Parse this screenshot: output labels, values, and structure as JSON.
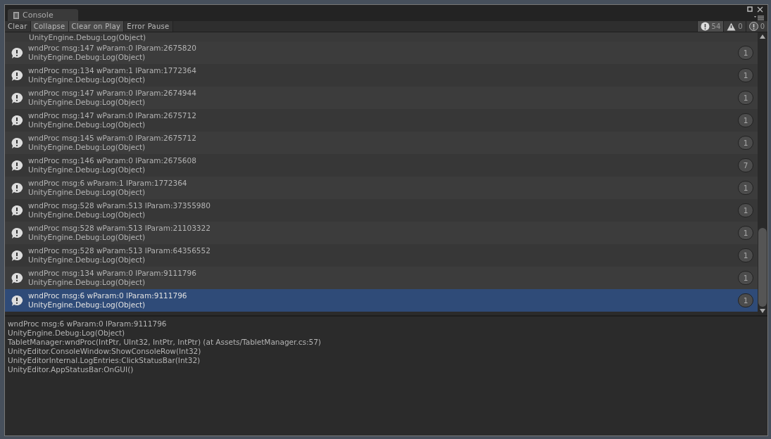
{
  "window": {
    "tab": "Console"
  },
  "toolbar": [
    {
      "label": "Clear",
      "kind": "button"
    },
    {
      "label": "Collapse",
      "kind": "toggle",
      "on": true
    },
    {
      "label": "Clear on Play",
      "kind": "toggle",
      "on": true
    },
    {
      "label": "Error Pause",
      "kind": "toggle",
      "on": false
    }
  ],
  "counters": [
    {
      "kind": "log",
      "count": "54",
      "on": true
    },
    {
      "kind": "warning",
      "count": "0",
      "on": false
    },
    {
      "kind": "error",
      "count": "0",
      "on": false
    }
  ],
  "partial_row": {
    "line2": "UnityEngine.Debug:Log(Object)"
  },
  "rows": [
    {
      "message": "wndProc msg:147 wParam:0 lParam:2675820",
      "source": "UnityEngine.Debug:Log(Object)",
      "count": "1",
      "selected": false
    },
    {
      "message": "wndProc msg:134 wParam:1 lParam:1772364",
      "source": "UnityEngine.Debug:Log(Object)",
      "count": "1",
      "selected": false
    },
    {
      "message": "wndProc msg:147 wParam:0 lParam:2674944",
      "source": "UnityEngine.Debug:Log(Object)",
      "count": "1",
      "selected": false
    },
    {
      "message": "wndProc msg:147 wParam:0 lParam:2675712",
      "source": "UnityEngine.Debug:Log(Object)",
      "count": "1",
      "selected": false
    },
    {
      "message": "wndProc msg:145 wParam:0 lParam:2675712",
      "source": "UnityEngine.Debug:Log(Object)",
      "count": "1",
      "selected": false
    },
    {
      "message": "wndProc msg:146 wParam:0 lParam:2675608",
      "source": "UnityEngine.Debug:Log(Object)",
      "count": "7",
      "selected": false
    },
    {
      "message": "wndProc msg:6 wParam:1 lParam:1772364",
      "source": "UnityEngine.Debug:Log(Object)",
      "count": "1",
      "selected": false
    },
    {
      "message": "wndProc msg:528 wParam:513 lParam:37355980",
      "source": "UnityEngine.Debug:Log(Object)",
      "count": "1",
      "selected": false
    },
    {
      "message": "wndProc msg:528 wParam:513 lParam:21103322",
      "source": "UnityEngine.Debug:Log(Object)",
      "count": "1",
      "selected": false
    },
    {
      "message": "wndProc msg:528 wParam:513 lParam:64356552",
      "source": "UnityEngine.Debug:Log(Object)",
      "count": "1",
      "selected": false
    },
    {
      "message": "wndProc msg:134 wParam:0 lParam:9111796",
      "source": "UnityEngine.Debug:Log(Object)",
      "count": "1",
      "selected": false
    },
    {
      "message": "wndProc msg:6 wParam:0 lParam:9111796",
      "source": "UnityEngine.Debug:Log(Object)",
      "count": "1",
      "selected": true
    }
  ],
  "details": [
    "wndProc msg:6 wParam:0 lParam:9111796",
    "UnityEngine.Debug:Log(Object)",
    "TabletManager:wndProc(IntPtr, UInt32, IntPtr, IntPtr) (at Assets/TabletManager.cs:57)",
    "UnityEditor.ConsoleWindow:ShowConsoleRow(Int32)",
    "UnityEditorInternal.LogEntries:ClickStatusBar(Int32)",
    "UnityEditor.AppStatusBar:OnGUI()"
  ]
}
